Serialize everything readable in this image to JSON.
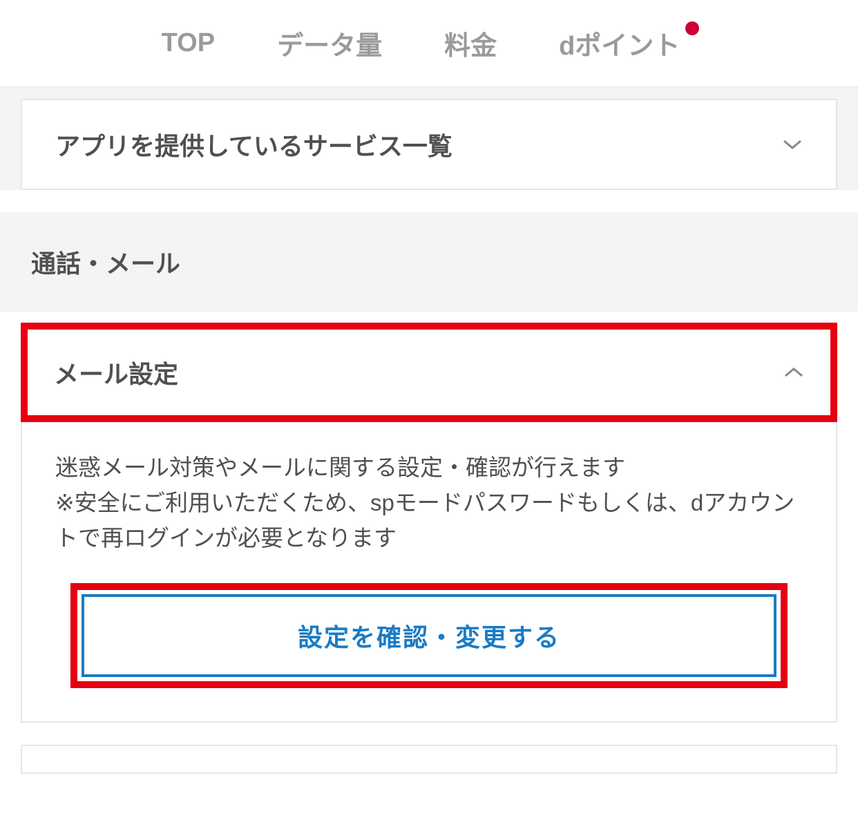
{
  "tabs": {
    "top": "TOP",
    "data": "データ量",
    "fee": "料金",
    "dpoint": "dポイント",
    "dpoint_has_badge": true
  },
  "apps_list": {
    "label": "アプリを提供しているサービス一覧"
  },
  "section": {
    "call_mail": "通話・メール"
  },
  "mail_settings": {
    "label": "メール設定",
    "description_line1": "迷惑メール対策やメールに関する設定・確認が行えます",
    "description_line2": "※安全にご利用いただくため、spモードパスワードもしくは、dアカウントで再ログインが必要となります",
    "button_label": "設定を確認・変更する"
  },
  "bottom_item": {
    "label_partial": ""
  }
}
